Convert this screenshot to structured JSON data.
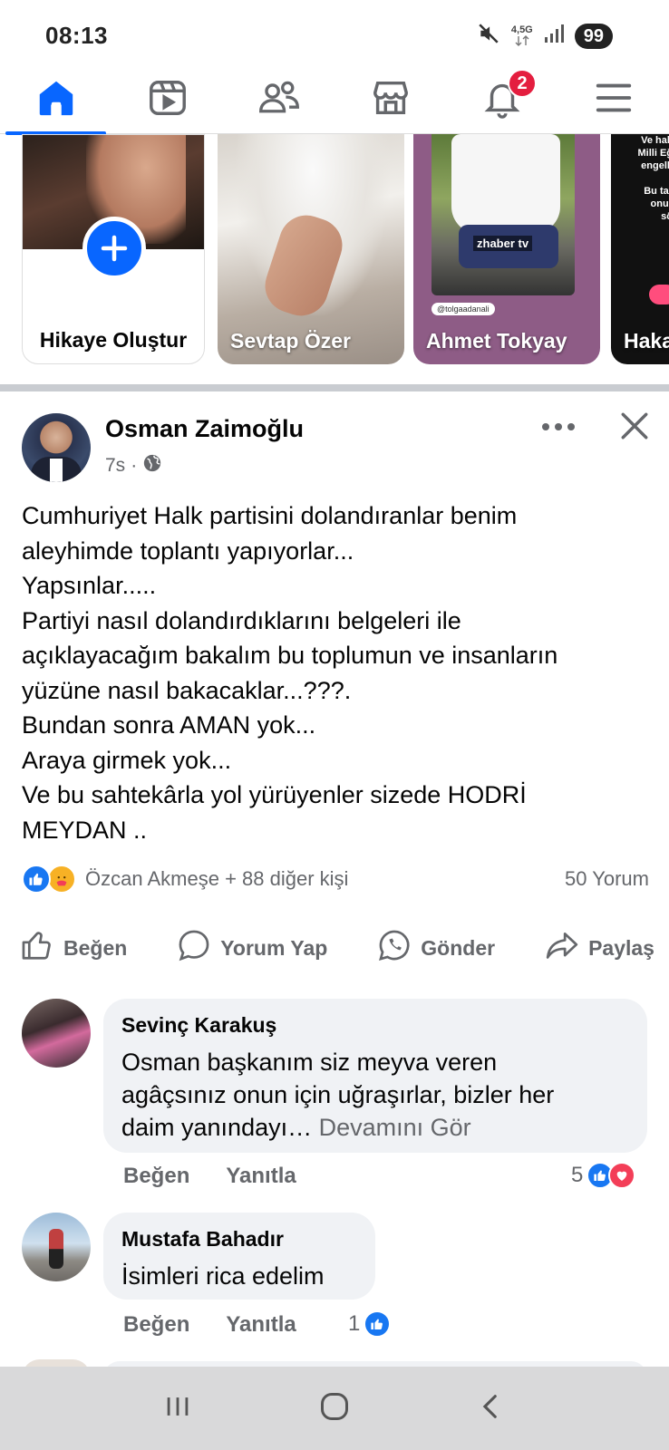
{
  "status_bar": {
    "time": "08:13",
    "network_label": "4,5G",
    "battery": "99",
    "icons": [
      "mute-icon",
      "signal-icon"
    ]
  },
  "nav": {
    "items": [
      {
        "name": "home",
        "icon": "home-icon",
        "active": true
      },
      {
        "name": "video",
        "icon": "video-icon",
        "active": false
      },
      {
        "name": "friends",
        "icon": "friends-icon",
        "active": false
      },
      {
        "name": "marketplace",
        "icon": "marketplace-icon",
        "active": false
      },
      {
        "name": "notifications",
        "icon": "bell-icon",
        "active": false,
        "badge": "2"
      },
      {
        "name": "menu",
        "icon": "menu-icon",
        "active": false
      }
    ],
    "accent": "#0866ff",
    "badge_color": "#e41e3f"
  },
  "stories": {
    "create_label": "Hikaye Oluştur",
    "items": [
      {
        "name": "Sevtap Özer"
      },
      {
        "name": "Ahmet Tokyay",
        "logo": "zhaber tv",
        "tag": "@tolgaadanali"
      },
      {
        "name": "Haka",
        "overlay": [
          "Ve hak",
          "Milli Eğ",
          "engelli",
          "",
          "Bu tar",
          "onur",
          "sö"
        ]
      }
    ]
  },
  "post": {
    "author": "Osman Zaimoğlu",
    "time": "7s",
    "privacy_icon": "globe-icon",
    "body_lines": [
      "Cumhuriyet Halk partisini dolandıranlar benim",
      "aleyhimde toplantı yapıyorlar...",
      "Yapsınlar.....",
      "Partiyi nasıl dolandırdıklarını belgeleri ile",
      "açıklayacağım bakalım bu toplumun ve  insanların",
      "yüzüne nasıl bakacaklar...???.",
      "Bundan sonra AMAN yok...",
      "Araya girmek yok...",
      "Ve bu sahtekârla yol yürüyenler sizede HODRİ",
      "MEYDAN .."
    ],
    "reactions_text": "Özcan Akmeşe + 88 diğer kişi",
    "comments_count": "50 Yorum",
    "actions": {
      "like": "Beğen",
      "comment": "Yorum Yap",
      "send": "Gönder",
      "share": "Paylaş"
    }
  },
  "comments": [
    {
      "author": "Sevinç Karakuş",
      "text_lines": [
        "Osman başkanım  siz meyva veren",
        "agâçsınız onun için uğraşırlar, bizler  her"
      ],
      "text_last": "daim yanındayı…",
      "see_more": "Devamını Gör",
      "like_label": "Beğen",
      "reply_label": "Yanıtla",
      "reaction_count": "5"
    },
    {
      "author": "Mustafa Bahadır",
      "text_lines": [
        "İsimleri rica edelim"
      ],
      "like_label": "Beğen",
      "reply_label": "Yanıtla",
      "reaction_count": "1"
    }
  ],
  "system_nav": {
    "icons": [
      "recent-apps-icon",
      "home-circle-icon",
      "back-icon"
    ]
  }
}
